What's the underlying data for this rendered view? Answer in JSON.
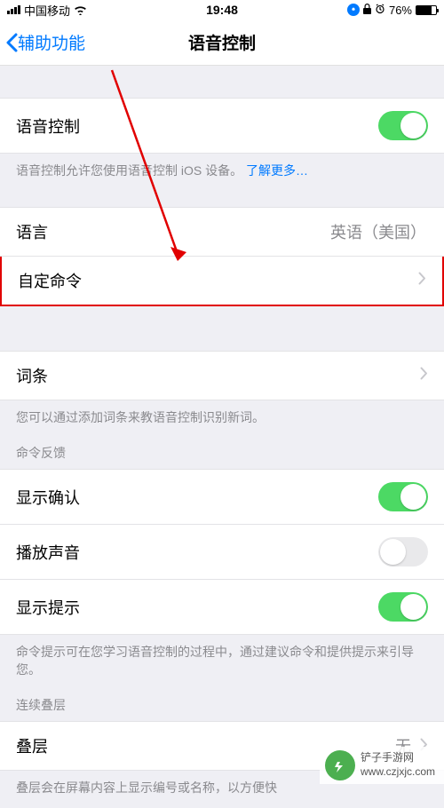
{
  "status": {
    "carrier": "中国移动",
    "time": "19:48",
    "battery_text": "76%"
  },
  "nav": {
    "back": "辅助功能",
    "title": "语音控制"
  },
  "rows": {
    "voice_control": "语音控制",
    "language_label": "语言",
    "language_value": "英语（美国）",
    "custom_commands": "自定命令",
    "vocabulary": "词条",
    "show_confirmation": "显示确认",
    "play_sound": "播放声音",
    "show_hints": "显示提示",
    "overlay": "叠层",
    "overlay_value": "无"
  },
  "footers": {
    "voice_control_desc": "语音控制允许您使用语音控制 iOS 设备。",
    "learn_more": "了解更多…",
    "vocabulary_desc": "您可以通过添加词条来教语音控制识别新词。",
    "hints_desc": "命令提示可在您学习语音控制的过程中，通过建议命令和提供提示来引导您。",
    "overlay_desc": "叠层会在屏幕内容上显示编号或名称，以方便快"
  },
  "headers": {
    "command_feedback": "命令反馈",
    "continuous_overlay": "连续叠层"
  },
  "watermark": {
    "line1": "铲子手游网",
    "line2": "www.czjxjc.com"
  }
}
